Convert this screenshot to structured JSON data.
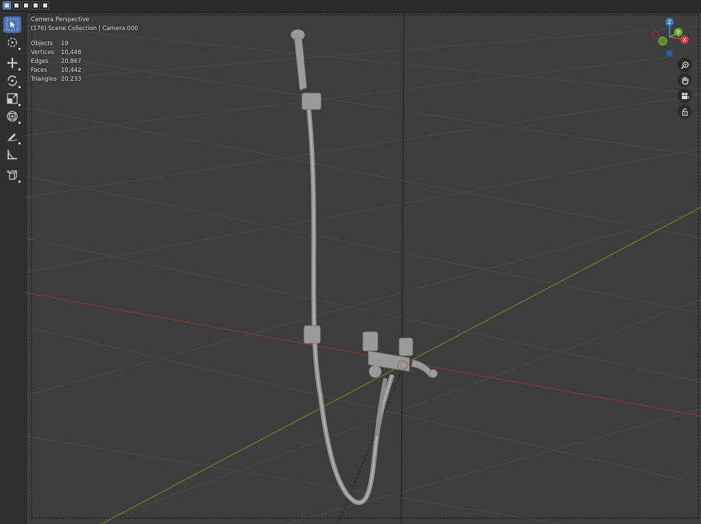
{
  "header": {
    "mode_buttons": [
      "select-box-icon",
      "select-extend-icon",
      "select-subtract-icon",
      "select-intersect-icon"
    ]
  },
  "toolbar": {
    "tools": [
      {
        "name": "select-box-tool",
        "icon": "cursor-arrow-icon",
        "active": true
      },
      {
        "name": "cursor-tool",
        "icon": "3d-cursor-icon",
        "active": false
      },
      {
        "name": "move-tool",
        "icon": "move-arrows-icon",
        "active": false
      },
      {
        "name": "rotate-tool",
        "icon": "rotate-icon",
        "active": false
      },
      {
        "name": "scale-tool",
        "icon": "scale-icon",
        "active": false
      },
      {
        "name": "transform-tool",
        "icon": "transform-icon",
        "active": false
      },
      {
        "name": "annotate-tool",
        "icon": "pencil-icon",
        "active": false
      },
      {
        "name": "measure-tool",
        "icon": "ruler-icon",
        "active": false
      },
      {
        "name": "add-cube-tool",
        "icon": "add-cube-icon",
        "active": false
      }
    ]
  },
  "viewport": {
    "view_name": "Camera Perspective",
    "collection_line": "(176) Scene Collection | Camera.000",
    "stats": [
      {
        "label": "Objects",
        "value": "19"
      },
      {
        "label": "Vertices",
        "value": "10,448"
      },
      {
        "label": "Edges",
        "value": "20,867"
      },
      {
        "label": "Faces",
        "value": "10,442"
      },
      {
        "label": "Triangles",
        "value": "20,233"
      }
    ],
    "gizmo": {
      "x_label": "X",
      "y_label": "Y",
      "z_label": "Z"
    },
    "nav_buttons": [
      "zoom-icon",
      "pan-hand-icon",
      "camera-view-icon",
      "lock-icon"
    ],
    "colors": {
      "background": "#3d3d3d",
      "grid": "#4a4a4a",
      "x_axis": "#8a3a3a",
      "y_axis": "#6a8a2a",
      "model": "#9a9a9a",
      "active_tool": "#4772b3"
    }
  }
}
